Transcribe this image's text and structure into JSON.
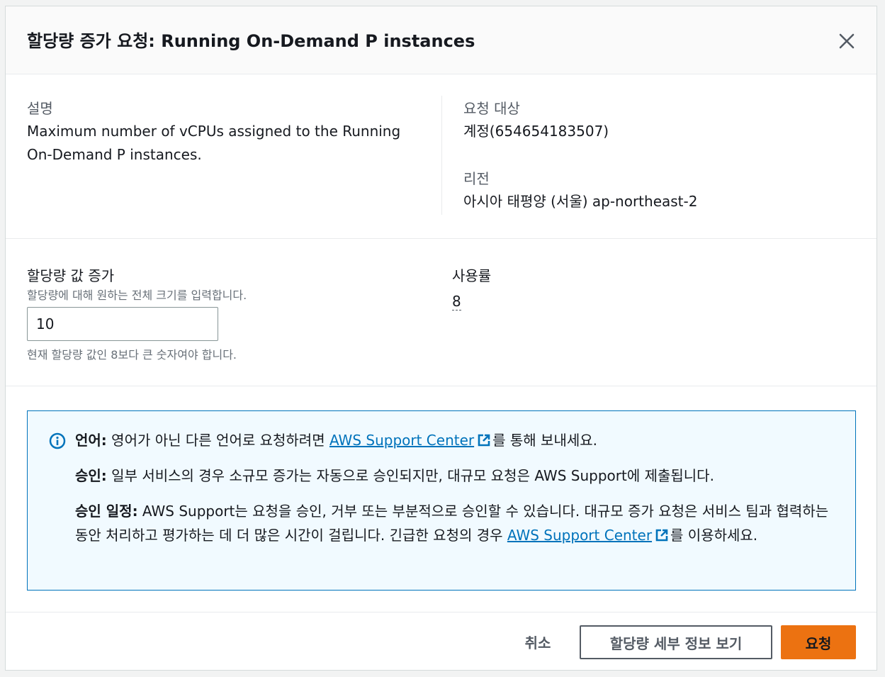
{
  "modal": {
    "title": "할당량 증가 요청: Running On-Demand P instances"
  },
  "details": {
    "description_label": "설명",
    "description_value": "Maximum number of vCPUs assigned to the Running On-Demand P instances.",
    "target_label": "요청 대상",
    "target_value": "계정(654654183507)",
    "region_label": "리전",
    "region_value": "아시아 태평양 (서울) ap-northeast-2"
  },
  "quota": {
    "label": "할당량 값 증가",
    "hint": "할당량에 대해 원하는 전체 크기를 입력합니다.",
    "value": "10",
    "constraint": "현재 할당량 값인 8보다 큰 숫자여야 합니다.",
    "usage_label": "사용률",
    "usage_value": "8"
  },
  "info": {
    "language_title": "언어:",
    "language_text": " 영어가 아닌 다른 언어로 요청하려면 ",
    "language_link": "AWS Support Center",
    "language_suffix": "를 통해 보내세요.",
    "approval_title": "승인:",
    "approval_text": " 일부 서비스의 경우 소규모 증가는 자동으로 승인되지만, 대규모 요청은 AWS Support에 제출됩니다.",
    "schedule_title": "승인 일정:",
    "schedule_text": " AWS Support는 요청을 승인, 거부 또는 부분적으로 승인할 수 있습니다. 대규모 증가 요청은 서비스 팀과 협력하는 동안 처리하고 평가하는 데 더 많은 시간이 걸립니다. 긴급한 요청의 경우 ",
    "schedule_link": "AWS Support Center",
    "schedule_suffix": "를 이용하세요."
  },
  "footer": {
    "cancel_label": "취소",
    "details_label": "할당량 세부 정보 보기",
    "submit_label": "요청"
  },
  "colors": {
    "primary_button": "#ec7211",
    "link": "#0073bb",
    "info_bg": "#f1faff"
  }
}
